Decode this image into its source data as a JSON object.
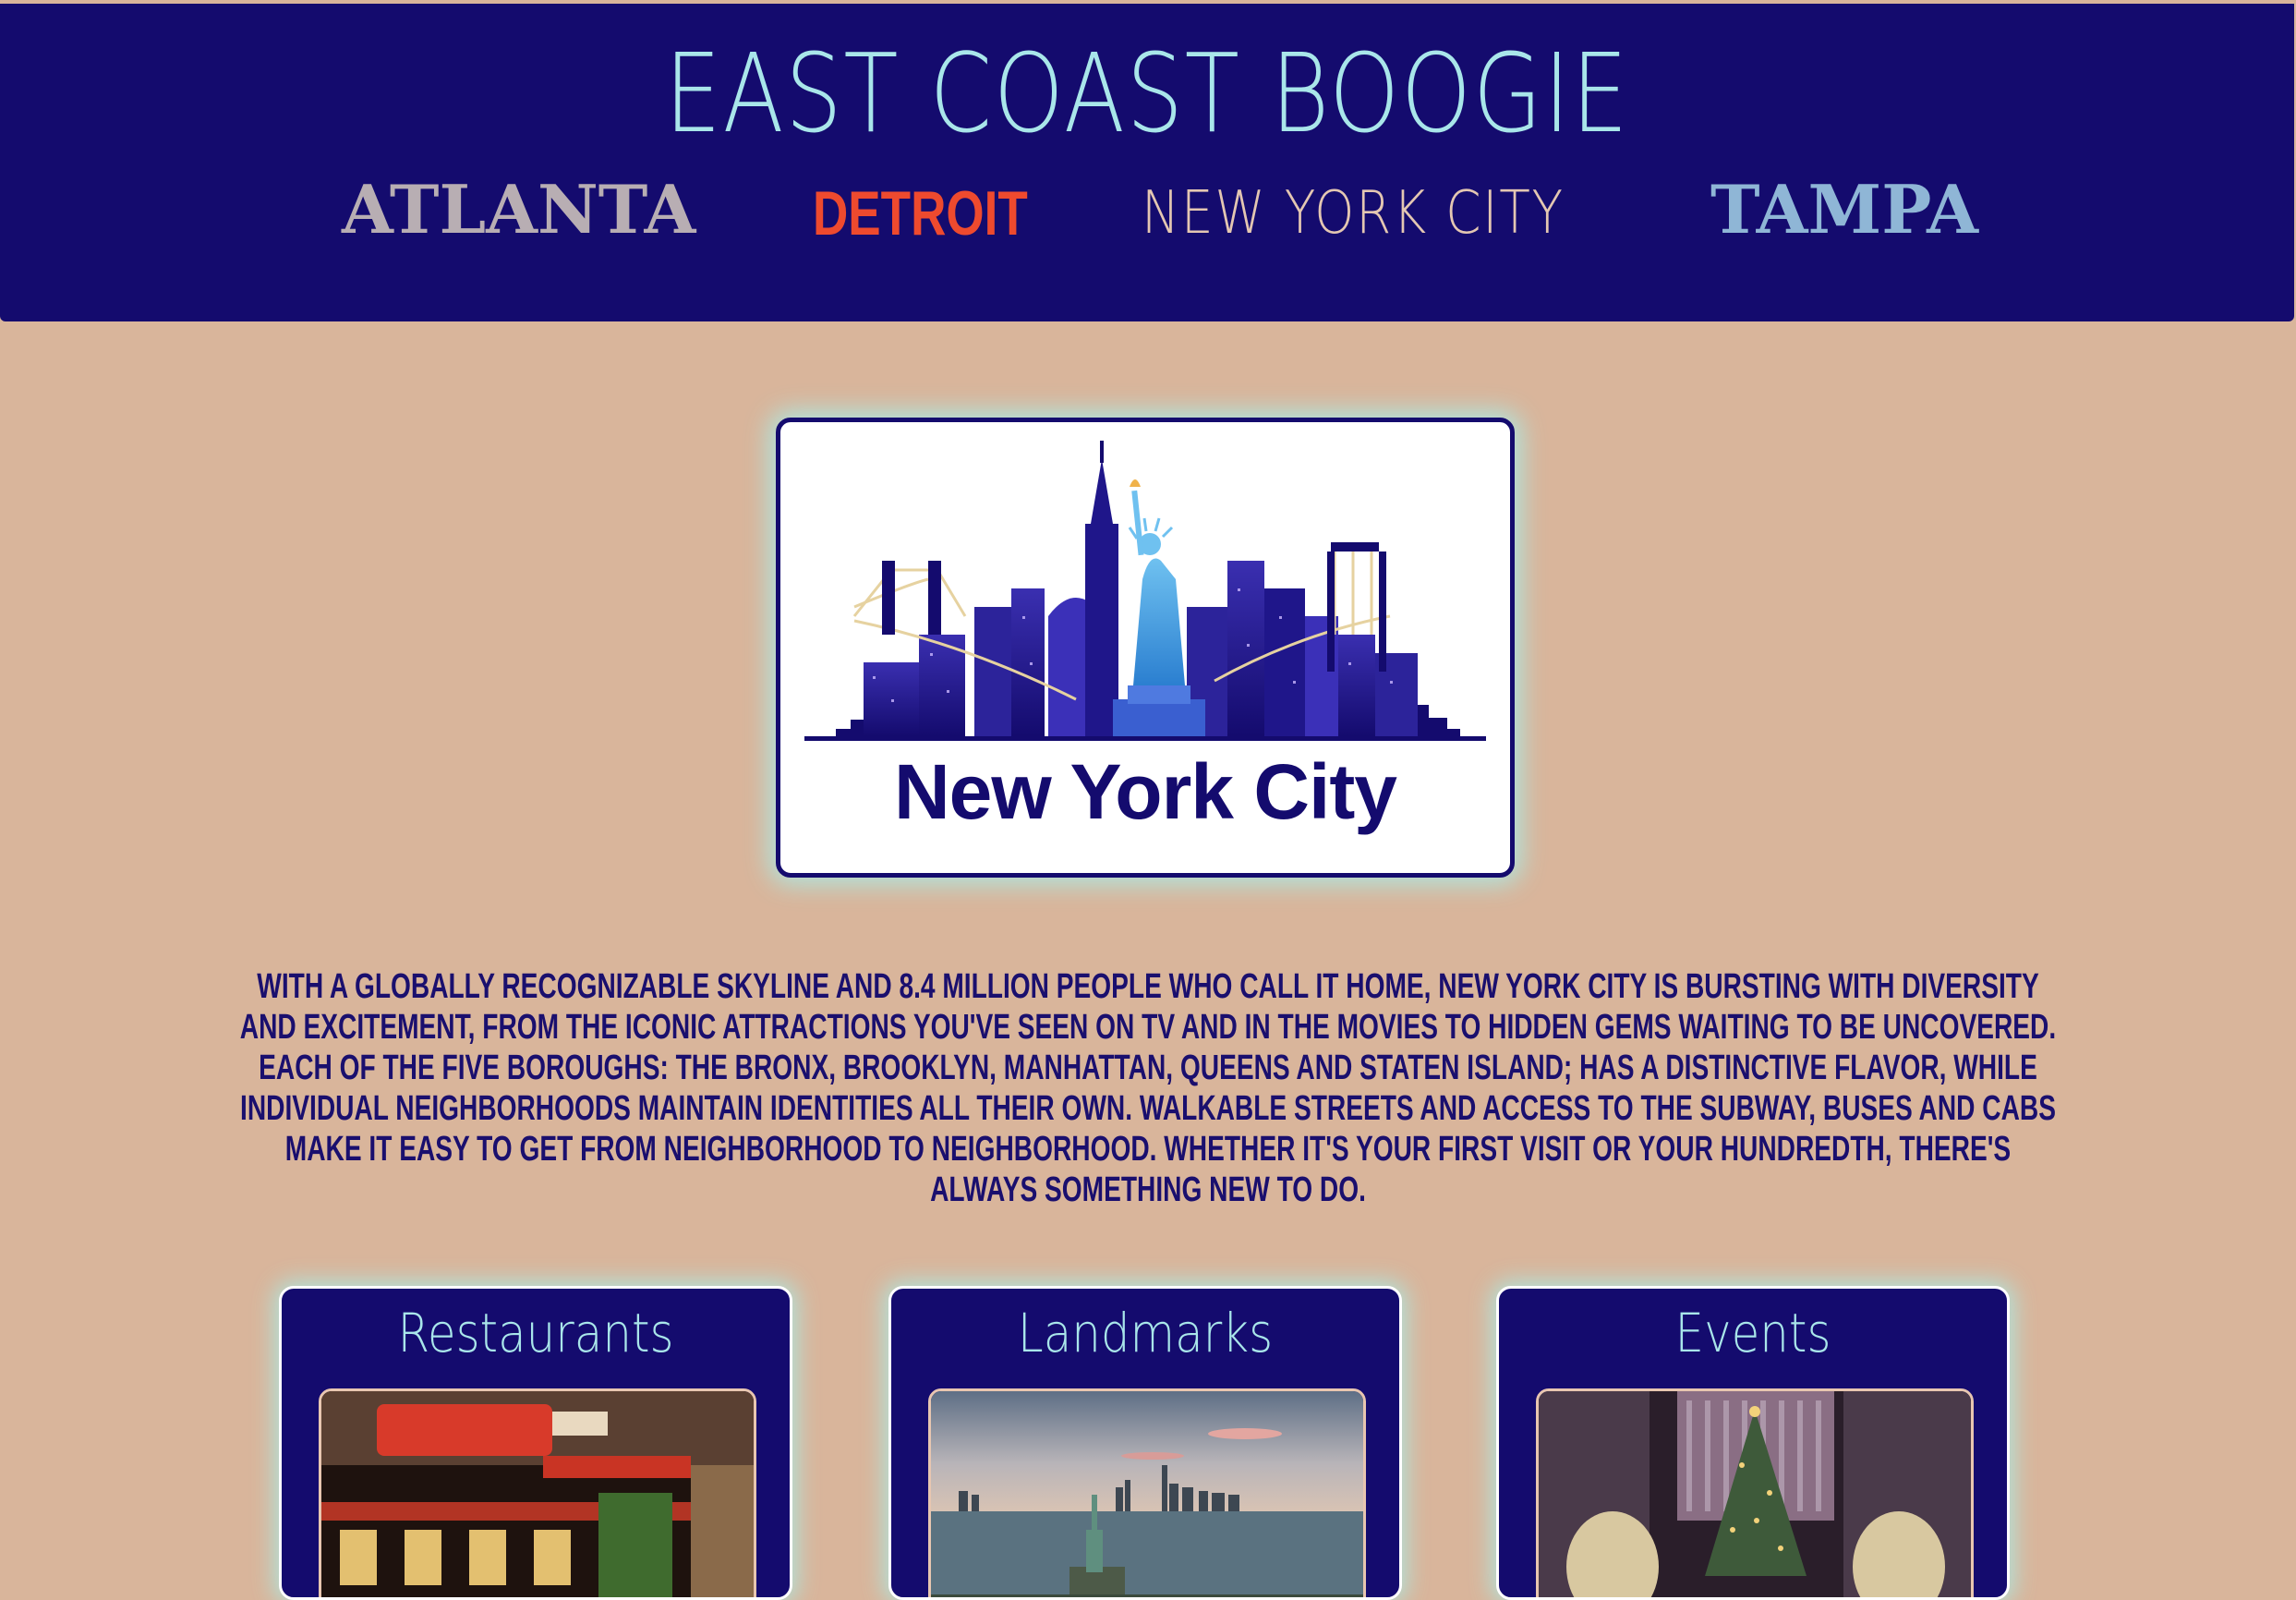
{
  "header": {
    "title": "EAST COAST BOOGIE",
    "nav": [
      {
        "label": "ATLANTA",
        "color": "#b8aeb3"
      },
      {
        "label": "DETROIT",
        "color": "#ee4a2e"
      },
      {
        "label": "NEW YORK CITY",
        "color": "#e4c7b2"
      },
      {
        "label": "TAMPA",
        "color": "#8fb6d6"
      }
    ]
  },
  "hero": {
    "image": "nyc-skyline-illustration",
    "caption": "New York City"
  },
  "description": "With a globally recognizable skyline and 8.4 million people who call it home, New York City is bursting with diversity and excitement, from the iconic attractions you've seen on TV and in the movies to hidden gems waiting to be uncovered. Each of the five boroughs: the Bronx, Brooklyn, Manhattan, Queens and Staten Island; has a distinctive flavor, while individual neighborhoods maintain identities all their own. Walkable streets and access to the subway, buses and cabs make it easy to get from neighborhood to neighborhood. Whether it's your first visit or your hundredth, there's always something new to do.",
  "cards": [
    {
      "title": "Restaurants",
      "image": "juniors-restaurant-photo"
    },
    {
      "title": "Landmarks",
      "image": "statue-of-liberty-harbor-photo"
    },
    {
      "title": "Events",
      "image": "rockefeller-christmas-tree-photo"
    }
  ],
  "colors": {
    "navy": "#140b6e",
    "background": "#d9b59b",
    "mint": "#a9e6ea"
  }
}
